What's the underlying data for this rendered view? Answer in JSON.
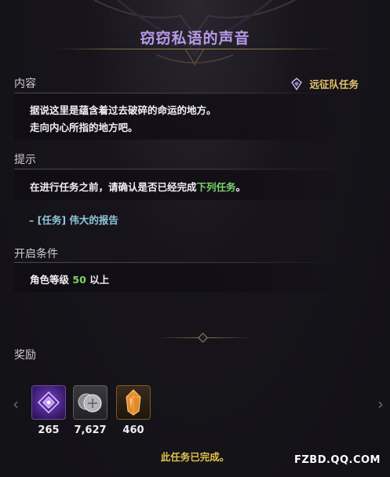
{
  "window": {
    "title": "窃窃私语的声音"
  },
  "content_section": {
    "label": "内容",
    "quest_type_label": "远征队任务",
    "quest_type_icon": "expedition-crest-icon",
    "lines": [
      "据说这里是蕴含着过去破碎的命运的地方。",
      "走向内心所指的地方吧。"
    ]
  },
  "hint_section": {
    "label": "提示",
    "text_before": "在进行任务之前，请确认是否已经完成",
    "text_highlight": "下列任务",
    "text_after": "。",
    "quest_link": "– [任务] 伟大的报告"
  },
  "conditions_section": {
    "label": "开启条件",
    "text_before": "角色等级",
    "level": "50",
    "text_after": "以上"
  },
  "rewards_section": {
    "label": "奖励",
    "items": [
      {
        "icon": "purple-crest-icon",
        "count": "265"
      },
      {
        "icon": "silver-coins-icon",
        "count": "7,627"
      },
      {
        "icon": "amber-crystal-icon",
        "count": "460"
      }
    ],
    "prev_icon": "chevron-left-icon",
    "next_icon": "chevron-right-icon"
  },
  "status": {
    "completed_text": "此任务已完成。"
  },
  "watermark": "FZBD.QQ.COM",
  "colors": {
    "title": "#b79ae6",
    "highlight_green": "#7dd36a",
    "link_blue": "#8fc7de",
    "gold": "#e0c24c"
  }
}
